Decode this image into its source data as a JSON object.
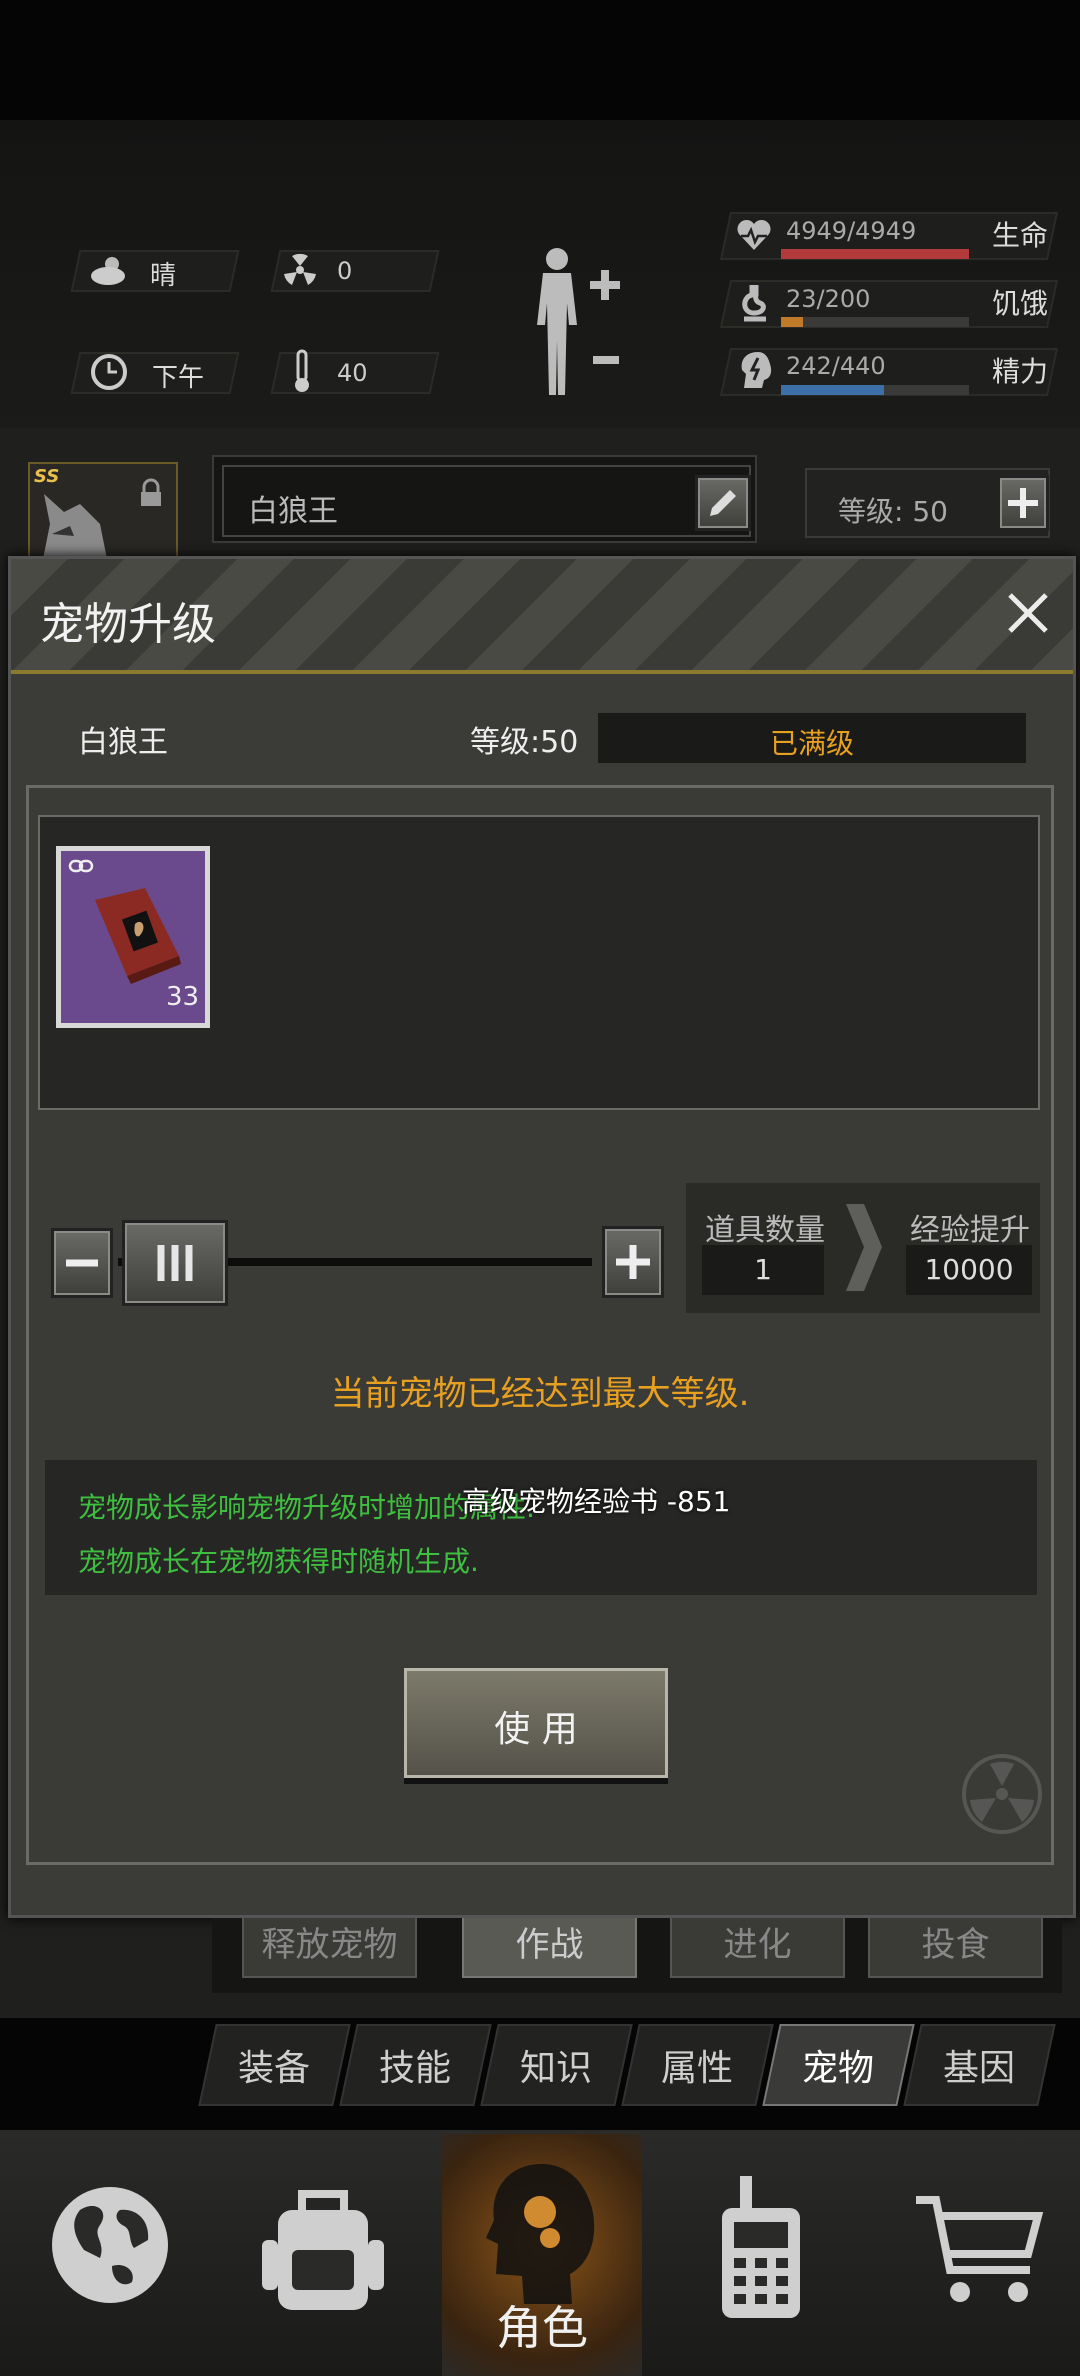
{
  "status": {
    "weather_label": "晴",
    "radiation_value": "0",
    "time_label": "下午",
    "temperature_value": "40",
    "life_value": "4949/4949",
    "life_label": "生命",
    "life_fraction": 1.0,
    "hunger_value": "23/200",
    "hunger_label": "饥饿",
    "hunger_fraction": 0.115,
    "energy_value": "242/440",
    "energy_label": "精力",
    "energy_fraction": 0.55
  },
  "pet_header": {
    "badge": "SS",
    "name": "白狼王",
    "level_text": "等级: 50"
  },
  "dialog": {
    "title": "宠物升级",
    "pet_name": "白狼王",
    "level_text": "等级:50",
    "max_level_badge": "已满级",
    "item_count": "33",
    "quantity_label": "道具数量",
    "quantity_value": "1",
    "exp_label": "经验提升",
    "exp_value": "10000",
    "max_level_message": "当前宠物已经达到最大等级.",
    "info_line1": "宠物成长影响宠物升级时增加的属性.",
    "info_line2": "宠物成长在宠物获得时随机生成.",
    "item_tooltip": "高级宠物经验书 -851",
    "use_button": "使 用",
    "slider_fraction": 0.0
  },
  "behind_buttons": [
    "释放宠物",
    "作战",
    "进化",
    "投食"
  ],
  "tabs": [
    {
      "label": "装备",
      "active": false
    },
    {
      "label": "技能",
      "active": false
    },
    {
      "label": "知识",
      "active": false
    },
    {
      "label": "属性",
      "active": false
    },
    {
      "label": "宠物",
      "active": true
    },
    {
      "label": "基因",
      "active": false
    }
  ],
  "bottom_nav": {
    "character_label": "角色"
  },
  "colors": {
    "accent_orange": "#e8a020",
    "life_bar": "#b33a3a",
    "hunger_bar": "#c07a2a",
    "energy_bar": "#3d6fa8",
    "info_green": "#3fbf3f"
  }
}
